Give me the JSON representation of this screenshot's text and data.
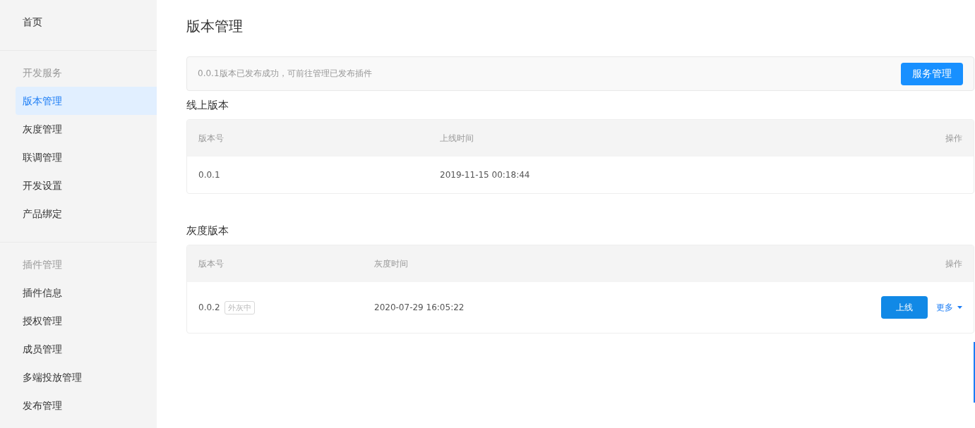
{
  "sidebar": {
    "groups": [
      {
        "items": [
          {
            "label": "首页",
            "selected": false
          }
        ]
      },
      {
        "title": "开发服务",
        "items": [
          {
            "label": "版本管理",
            "selected": true
          },
          {
            "label": "灰度管理",
            "selected": false
          },
          {
            "label": "联调管理",
            "selected": false
          },
          {
            "label": "开发设置",
            "selected": false
          },
          {
            "label": "产品绑定",
            "selected": false
          }
        ]
      },
      {
        "title": "插件管理",
        "items": [
          {
            "label": "插件信息",
            "selected": false
          },
          {
            "label": "授权管理",
            "selected": false
          },
          {
            "label": "成员管理",
            "selected": false
          },
          {
            "label": "多端投放管理",
            "selected": false
          },
          {
            "label": "发布管理",
            "selected": false
          }
        ]
      }
    ]
  },
  "page_title": "版本管理",
  "notice": {
    "text": "0.0.1版本已发布成功，可前往管理已发布插件",
    "button": "服务管理"
  },
  "sections": [
    {
      "title": "线上版本",
      "columns": [
        "版本号",
        "上线时间",
        "操作"
      ],
      "rows": [
        {
          "version": "0.0.1",
          "time": "2019-11-15 00:18:44"
        }
      ]
    },
    {
      "title": "灰度版本",
      "columns": [
        "版本号",
        "灰度时间",
        "操作"
      ],
      "rows": [
        {
          "version": "0.0.2",
          "tag": "外灰中",
          "time": "2020-07-29 16:05:22",
          "actions": [
            {
              "kind": "button",
              "label": "上线"
            },
            {
              "kind": "dropdown",
              "label": "更多"
            }
          ]
        }
      ]
    }
  ]
}
